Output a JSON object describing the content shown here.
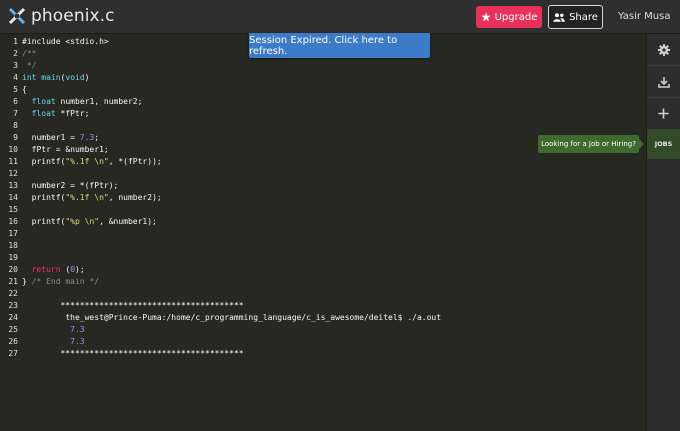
{
  "app": {
    "title": "phoenix.c"
  },
  "toolbar": {
    "upgrade_label": "Upgrade",
    "share_label": "Share",
    "user_name": "Yasir Musa"
  },
  "banner": {
    "text": "Session Expired. Click here to refresh."
  },
  "sidebar": {
    "jobs_label": "JOBS",
    "jobs_tooltip": "Looking for a Job or Hiring?"
  },
  "code_lines": [
    {
      "n": "1",
      "segments": [
        {
          "t": "#include <stdio.h>",
          "c": "mac"
        }
      ]
    },
    {
      "n": "2",
      "segments": [
        {
          "t": "/**",
          "c": "cm"
        }
      ]
    },
    {
      "n": "3",
      "segments": [
        {
          "t": " */",
          "c": "cm"
        }
      ]
    },
    {
      "n": "4",
      "segments": [
        {
          "t": "int",
          "c": "k"
        },
        {
          "t": " "
        },
        {
          "t": "main",
          "c": "k"
        },
        {
          "t": "("
        },
        {
          "t": "void",
          "c": "k"
        },
        {
          "t": ")"
        }
      ]
    },
    {
      "n": "5",
      "segments": [
        {
          "t": "{"
        }
      ]
    },
    {
      "n": "6",
      "segments": [
        {
          "t": "  "
        },
        {
          "t": "float",
          "c": "k"
        },
        {
          "t": " number1, number2;"
        }
      ]
    },
    {
      "n": "7",
      "segments": [
        {
          "t": "  "
        },
        {
          "t": "float",
          "c": "k"
        },
        {
          "t": " *fPtr;"
        }
      ]
    },
    {
      "n": "8",
      "segments": []
    },
    {
      "n": "9",
      "segments": [
        {
          "t": "  number1 = "
        },
        {
          "t": "7.3",
          "c": "num"
        },
        {
          "t": ";"
        }
      ]
    },
    {
      "n": "10",
      "segments": [
        {
          "t": "  fPtr = &number1;"
        }
      ]
    },
    {
      "n": "11",
      "segments": [
        {
          "t": "  printf("
        },
        {
          "t": "\"%.1f \\n\"",
          "c": "str"
        },
        {
          "t": ", *(fPtr));"
        }
      ]
    },
    {
      "n": "12",
      "segments": []
    },
    {
      "n": "13",
      "segments": [
        {
          "t": "  number2 = *(fPtr);"
        }
      ]
    },
    {
      "n": "14",
      "segments": [
        {
          "t": "  printf("
        },
        {
          "t": "\"%.1f \\n\"",
          "c": "str"
        },
        {
          "t": ", number2);"
        }
      ]
    },
    {
      "n": "15",
      "segments": []
    },
    {
      "n": "16",
      "segments": [
        {
          "t": "  printf("
        },
        {
          "t": "\"%p \\n\"",
          "c": "str"
        },
        {
          "t": ", &number1);"
        }
      ]
    },
    {
      "n": "17",
      "segments": []
    },
    {
      "n": "18",
      "segments": []
    },
    {
      "n": "19",
      "segments": []
    },
    {
      "n": "20",
      "segments": [
        {
          "t": "  "
        },
        {
          "t": "return",
          "c": "ret"
        },
        {
          "t": " ("
        },
        {
          "t": "0",
          "c": "num"
        },
        {
          "t": ");"
        }
      ]
    },
    {
      "n": "21",
      "segments": [
        {
          "t": "} "
        },
        {
          "t": "/* End main */",
          "c": "cm"
        }
      ]
    },
    {
      "n": "22",
      "segments": []
    },
    {
      "n": "23",
      "segments": [
        {
          "t": "        **************************************"
        }
      ]
    },
    {
      "n": "24",
      "segments": [
        {
          "t": "         the_west@Prince-Puma:/home/c_programming_language/c_is_awesome/deitel$ ./a.out"
        }
      ]
    },
    {
      "n": "25",
      "segments": [
        {
          "t": "          "
        },
        {
          "t": "7.3",
          "c": "num"
        }
      ]
    },
    {
      "n": "26",
      "segments": [
        {
          "t": "          "
        },
        {
          "t": "7.3",
          "c": "num"
        }
      ]
    },
    {
      "n": "27",
      "segments": [
        {
          "t": "        **************************************"
        }
      ]
    }
  ]
}
